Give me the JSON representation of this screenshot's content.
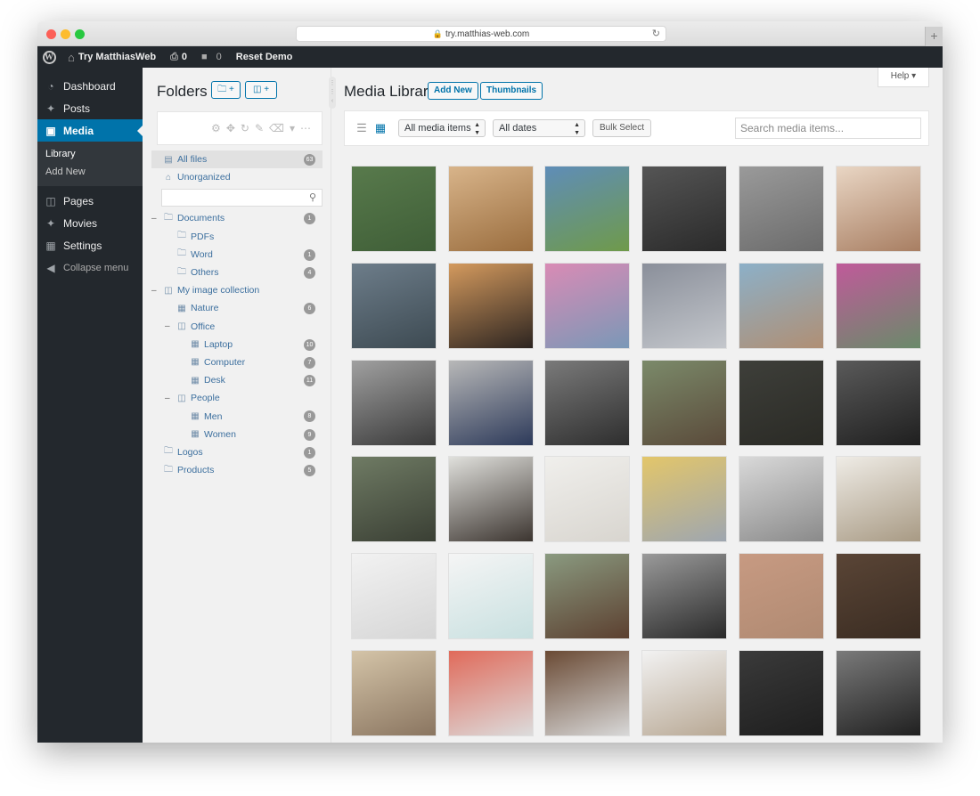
{
  "browser": {
    "url": "try.matthias-web.com"
  },
  "adminbar": {
    "site_name": "Try MatthiasWeb",
    "updates_count": "0",
    "comments_count": "0",
    "reset_label": "Reset Demo"
  },
  "sidebar": {
    "items": [
      {
        "label": "Dashboard",
        "icon": "dashboard-icon"
      },
      {
        "label": "Posts",
        "icon": "pin-icon"
      },
      {
        "label": "Media",
        "icon": "media-icon"
      },
      {
        "label": "Pages",
        "icon": "pages-icon"
      },
      {
        "label": "Movies",
        "icon": "pin-icon"
      },
      {
        "label": "Settings",
        "icon": "settings-icon"
      }
    ],
    "submenu": [
      "Library",
      "Add New"
    ],
    "collapse_label": "Collapse menu"
  },
  "folders": {
    "title": "Folders",
    "new_folder_label": "+",
    "new_collection_label": "+",
    "tree": [
      {
        "label": "All files",
        "count": "63"
      },
      {
        "label": "Unorganized",
        "count": ""
      },
      {
        "label": "Documents",
        "count": "1"
      },
      {
        "label": "PDFs",
        "count": ""
      },
      {
        "label": "Word",
        "count": "1"
      },
      {
        "label": "Others",
        "count": "4"
      },
      {
        "label": "My image collection",
        "count": ""
      },
      {
        "label": "Nature",
        "count": "6"
      },
      {
        "label": "Office",
        "count": ""
      },
      {
        "label": "Laptop",
        "count": "10"
      },
      {
        "label": "Computer",
        "count": "7"
      },
      {
        "label": "Desk",
        "count": "11"
      },
      {
        "label": "People",
        "count": ""
      },
      {
        "label": "Men",
        "count": "8"
      },
      {
        "label": "Women",
        "count": "9"
      },
      {
        "label": "Logos",
        "count": "1"
      },
      {
        "label": "Products",
        "count": "5"
      }
    ]
  },
  "main": {
    "title": "Media Library",
    "add_new_label": "Add New",
    "thumbnails_label": "Thumbnails",
    "help_label": "Help",
    "type_filter": "All media items",
    "date_filter": "All dates",
    "bulk_select_label": "Bulk Select",
    "search_placeholder": "Search media items...",
    "thumbnails": [
      {
        "top": "#587a4c",
        "bottom": "#3f5e37"
      },
      {
        "top": "#d8b48a",
        "bottom": "#9a6d3e"
      },
      {
        "top": "#5f8db8",
        "bottom": "#6f9a4a"
      },
      {
        "top": "#555555",
        "bottom": "#2a2a2a"
      },
      {
        "top": "#9a9a9a",
        "bottom": "#6b6b6b"
      },
      {
        "top": "#e9d6c4",
        "bottom": "#a87e62"
      },
      {
        "top": "#6d7d8a",
        "bottom": "#3d4a52"
      },
      {
        "top": "#d49a5e",
        "bottom": "#2c2420"
      },
      {
        "top": "#d98bb5",
        "bottom": "#7a98b7"
      },
      {
        "top": "#8a8f9a",
        "bottom": "#c4c7cc"
      },
      {
        "top": "#8cb0c8",
        "bottom": "#b08f74"
      },
      {
        "top": "#c05a9a",
        "bottom": "#6a8a6a"
      },
      {
        "top": "#a0a0a0",
        "bottom": "#3a3a3a"
      },
      {
        "top": "#b8b8b8",
        "bottom": "#2d3a5a"
      },
      {
        "top": "#7a7a7a",
        "bottom": "#2e2e2e"
      },
      {
        "top": "#7b8a6a",
        "bottom": "#5a4a3a"
      },
      {
        "top": "#3e3f3a",
        "bottom": "#2a2a25"
      },
      {
        "top": "#5a5a5a",
        "bottom": "#1f1f1f"
      },
      {
        "top": "#6f7b64",
        "bottom": "#3a3f34"
      },
      {
        "top": "#e0e0dc",
        "bottom": "#3c3530"
      },
      {
        "top": "#f0efec",
        "bottom": "#d8d5cf"
      },
      {
        "top": "#e3c66a",
        "bottom": "#9ea6b0"
      },
      {
        "top": "#d9d9d9",
        "bottom": "#8a8a8a"
      },
      {
        "top": "#efece6",
        "bottom": "#a89a84"
      },
      {
        "top": "#f2f2f2",
        "bottom": "#d6d6d6"
      },
      {
        "top": "#f5f5f5",
        "bottom": "#c8e0e0"
      },
      {
        "top": "#8a9a80",
        "bottom": "#5c4030"
      },
      {
        "top": "#9a9a9a",
        "bottom": "#2a2a2a"
      },
      {
        "top": "#c79a82",
        "bottom": "#b08a72"
      },
      {
        "top": "#5a4536",
        "bottom": "#3a2c22"
      },
      {
        "top": "#d4c4a8",
        "bottom": "#8a7560"
      },
      {
        "top": "#e06a5a",
        "bottom": "#dcdcdc"
      },
      {
        "top": "#6a4a34",
        "bottom": "#d8d8d8"
      },
      {
        "top": "#f2f2f2",
        "bottom": "#b8a894"
      },
      {
        "top": "#3a3a3a",
        "bottom": "#1e1e1e"
      },
      {
        "top": "#7a7a7a",
        "bottom": "#202020"
      }
    ]
  },
  "colors": {
    "admin_bg": "#23282d",
    "accent": "#0073aa",
    "link": "#3c6f9e"
  }
}
